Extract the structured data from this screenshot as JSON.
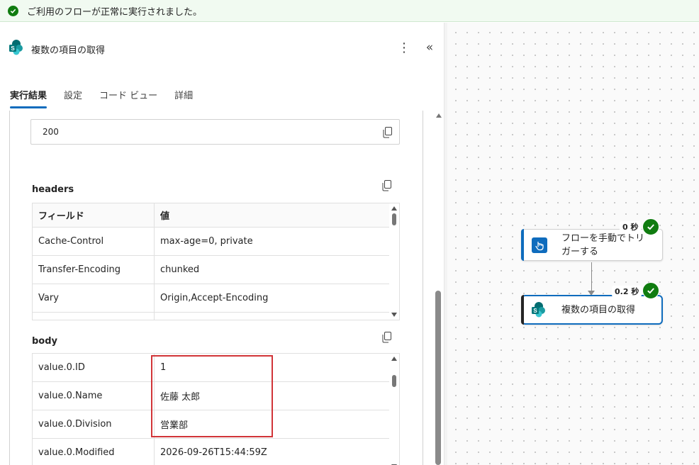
{
  "banner": {
    "message": "ご利用のフローが正常に実行されました。"
  },
  "panel": {
    "title": "複数の項目の取得",
    "tabs": [
      {
        "label": "実行結果",
        "active": true
      },
      {
        "label": "設定",
        "active": false
      },
      {
        "label": "コード ビュー",
        "active": false
      },
      {
        "label": "詳細",
        "active": false
      }
    ],
    "status_code": "200",
    "headers": {
      "label": "headers",
      "columns": [
        "フィールド",
        "値"
      ],
      "rows": [
        [
          "Cache-Control",
          "max-age=0, private"
        ],
        [
          "Transfer-Encoding",
          "chunked"
        ],
        [
          "Vary",
          "Origin,Accept-Encoding"
        ]
      ]
    },
    "body": {
      "label": "body",
      "rows": [
        [
          "value.0.ID",
          "1"
        ],
        [
          "value.0.Name",
          "佐藤 太郎"
        ],
        [
          "value.0.Division",
          "営業部"
        ],
        [
          "value.0.Modified",
          "2026-09-26T15:44:59Z"
        ]
      ]
    }
  },
  "canvas": {
    "nodes": [
      {
        "label_line1": "フローを手動でトリ",
        "label_line2": "ガーする",
        "duration": "0 秒",
        "icon": "touch-icon",
        "accent": "#0f6cbd"
      },
      {
        "label": "複数の項目の取得",
        "duration": "0.2 秒",
        "icon": "sharepoint-icon",
        "accent": "#242424"
      }
    ]
  },
  "colors": {
    "success": "#107c10",
    "accent": "#0f6cbd",
    "highlight": "#d13438"
  }
}
